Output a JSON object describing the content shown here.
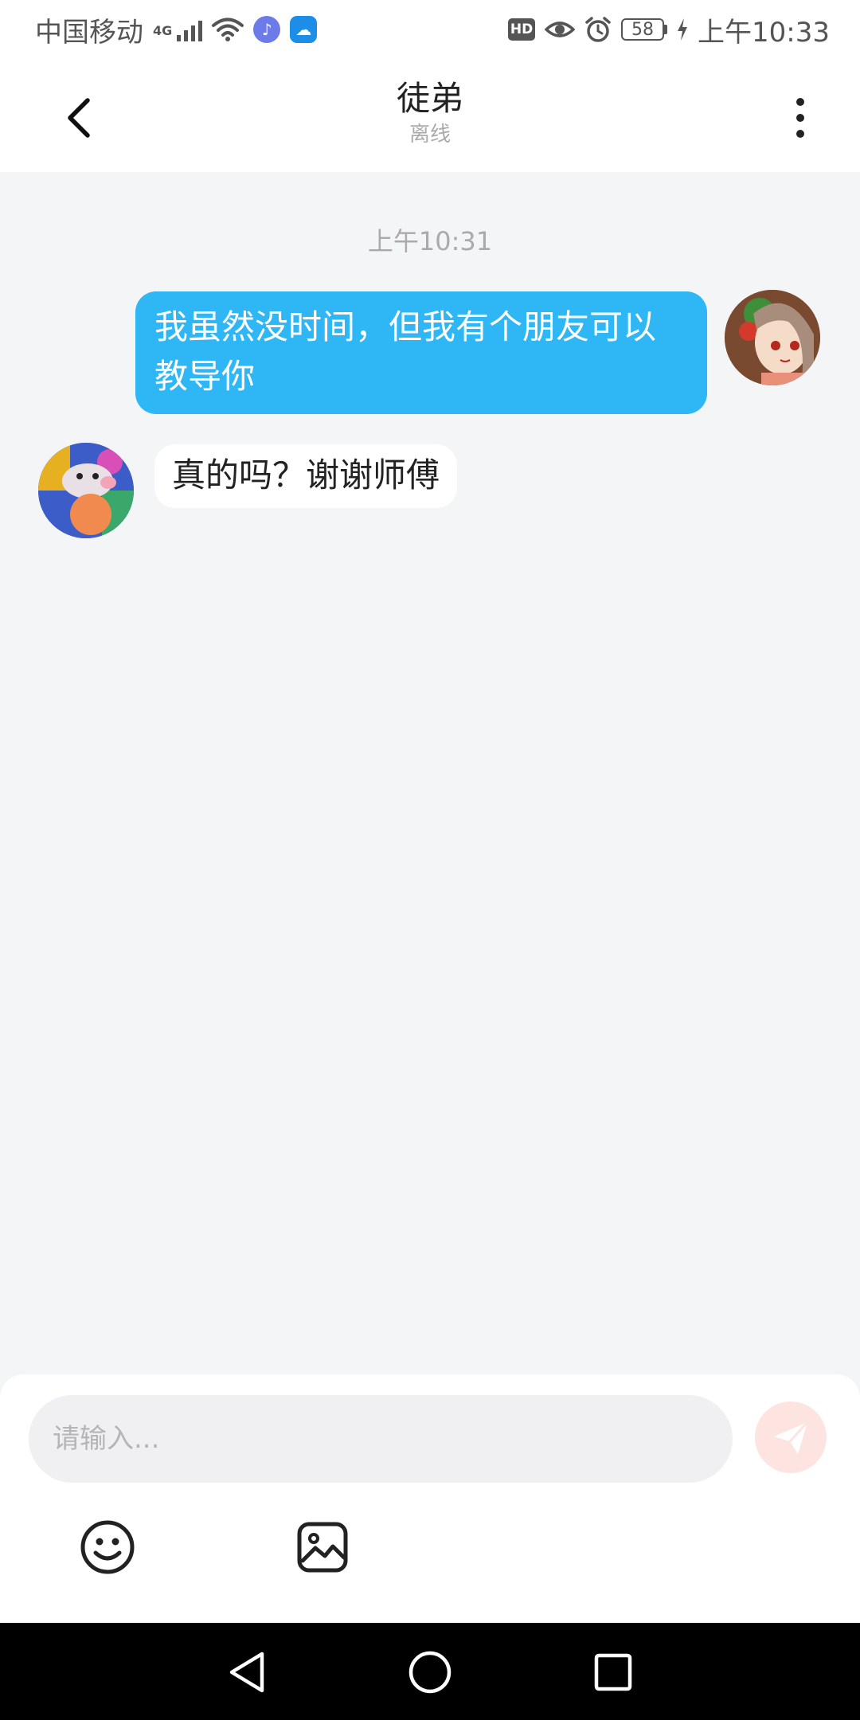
{
  "status_bar": {
    "carrier": "中国移动",
    "network": "4G",
    "time": "上午10:33",
    "battery_level": "58",
    "hd_label": "HD",
    "icons": [
      "signal-icon",
      "wifi-icon",
      "music-app-icon",
      "weather-app-icon",
      "hd-icon",
      "eye-icon",
      "alarm-icon",
      "battery-icon",
      "charging-icon"
    ]
  },
  "header": {
    "title": "徒弟",
    "subtitle": "离线",
    "back_icon": "chevron-left-icon",
    "more_icon": "more-vertical-icon"
  },
  "messages": {
    "timestamp": "上午10:31",
    "items": [
      {
        "sender": "me",
        "text": "我虽然没时间，但我有个朋友可以教导你"
      },
      {
        "sender": "peer",
        "text": "真的吗？谢谢师傅"
      }
    ]
  },
  "composer": {
    "placeholder": "请输入...",
    "value": "",
    "send_icon": "send-icon",
    "tools": [
      "emoji-icon",
      "image-icon"
    ]
  },
  "colors": {
    "accent": "#2fb6f5",
    "background": "#f4f5f7",
    "send_button": "#fde4e1",
    "send_icon": "#ffffff"
  },
  "navigation": {
    "icons": [
      "nav-back-icon",
      "nav-home-icon",
      "nav-recent-icon"
    ]
  }
}
